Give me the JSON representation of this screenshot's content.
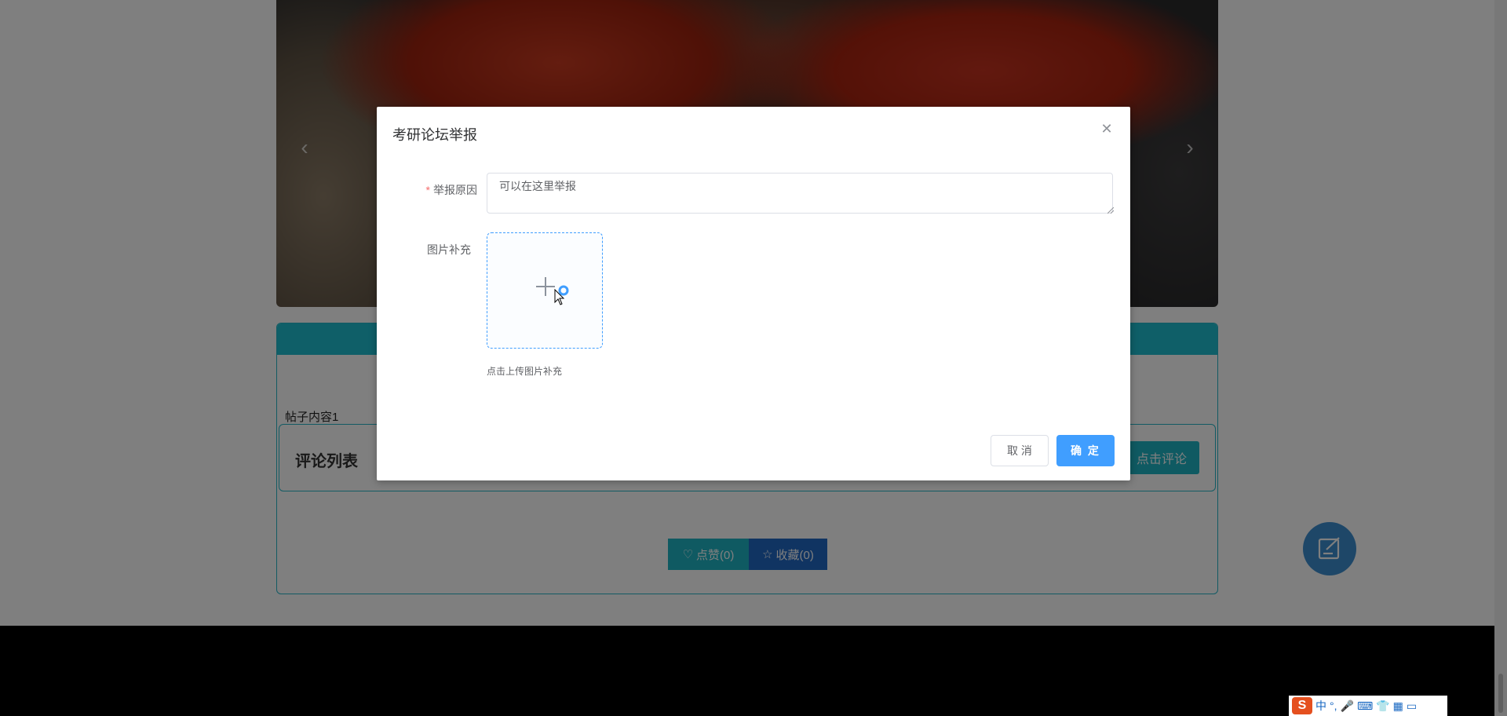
{
  "post": {
    "content": "帖子内容1",
    "comment_list_title": "评论列表",
    "comment_button": "点击评论",
    "like_label": "点赞(0)",
    "favorite_label": "收藏(0)"
  },
  "dialog": {
    "title": "考研论坛举报",
    "reason_label": "举报原因",
    "reason_value": "可以在这里举报",
    "image_label": "图片补充",
    "upload_tip": "点击上传图片补充",
    "cancel_label": "取 消",
    "confirm_label": "确 定"
  },
  "ime": {
    "logo": "S",
    "mode": "中"
  },
  "colors": {
    "accent": "#409eff",
    "teal": "#1fb5c5",
    "navy": "#2168c4",
    "required": "#f56c6c"
  }
}
